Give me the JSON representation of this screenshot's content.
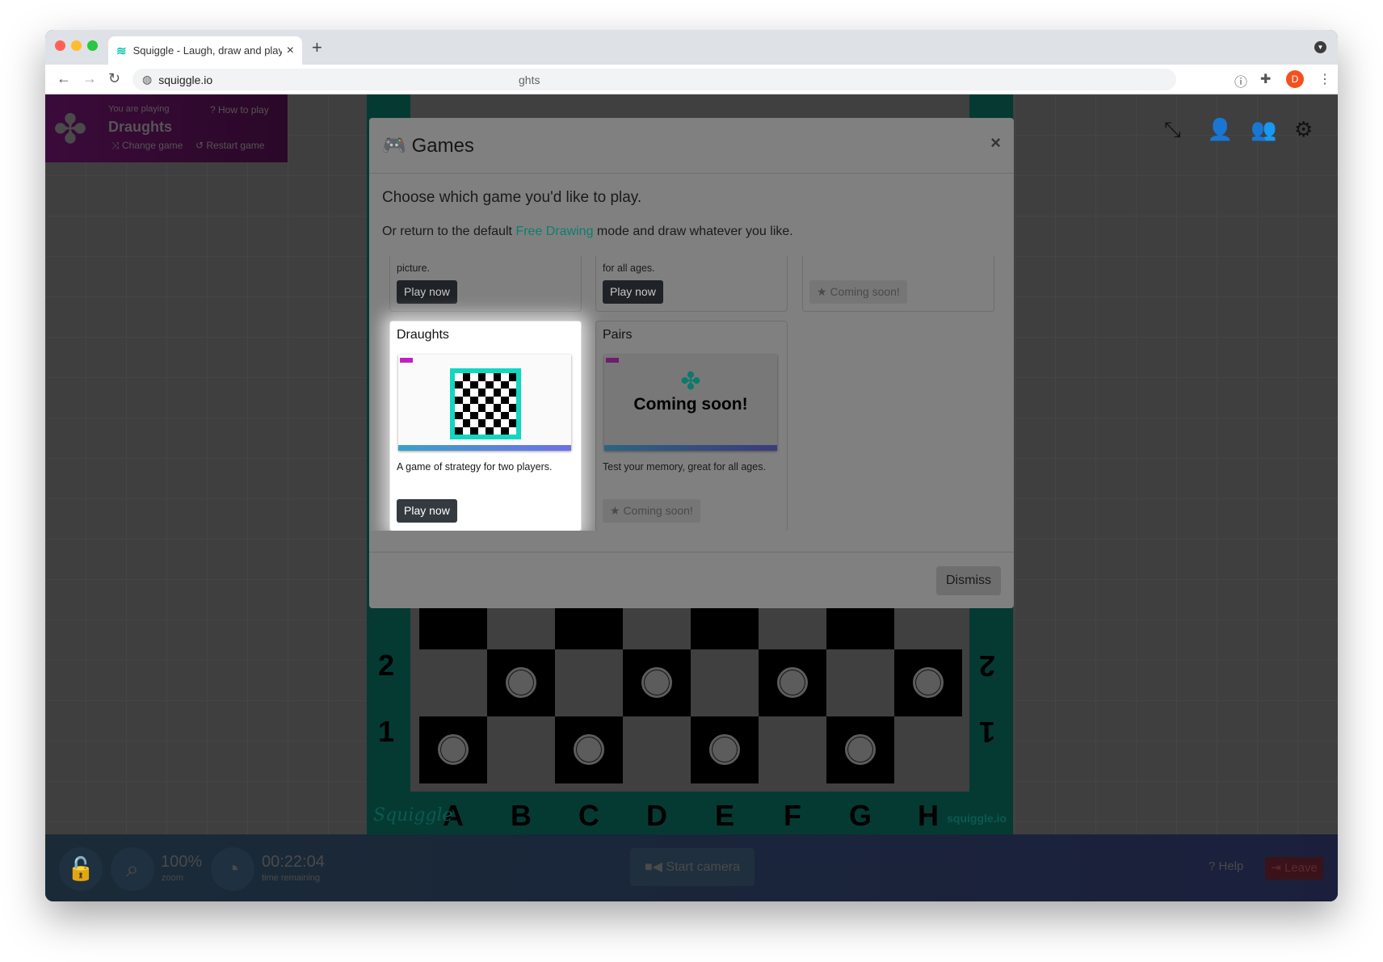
{
  "browser": {
    "tab_title": "Squiggle - Laugh, draw and play",
    "url": "squiggle.io",
    "omnibox_overflow_text": "ghts",
    "profile_initial": "D",
    "new_tab": "+",
    "close_tab": "×"
  },
  "game_panel": {
    "caption": "You are playing",
    "game_name": "Draughts",
    "how_to_play": "How to play",
    "change_game": "Change game",
    "restart_game": "Restart game"
  },
  "modal": {
    "title": "Games",
    "close": "×",
    "lead": "Choose which game you'd like to play.",
    "sub_before": "Or return to the default",
    "sub_link": "Free Drawing",
    "sub_after": "mode and draw whatever you like.",
    "top_row": [
      {
        "desc_tail": "picture.",
        "button": "Play now"
      },
      {
        "desc_tail": "for all ages.",
        "button": "Play now"
      },
      {
        "desc_tail": "",
        "button": "★ Coming soon!"
      }
    ],
    "cards": [
      {
        "title": "Draughts",
        "desc": "A game of strategy for two players.",
        "button": "Play now",
        "highlighted": true
      },
      {
        "title": "Pairs",
        "desc": "Test your memory, great for all ages.",
        "button": "★ Coming soon!",
        "thumb_text": "Coming soon!"
      }
    ],
    "dismiss": "Dismiss"
  },
  "board": {
    "ranks": [
      "2",
      "1"
    ],
    "files": [
      "A",
      "B",
      "C",
      "D",
      "E",
      "F",
      "G",
      "H"
    ],
    "brand_left": "Squiggle",
    "brand_right": "squiggle.io",
    "colors": {
      "frame": "#0fd3bd",
      "dark_square": "#000000"
    }
  },
  "bottom_bar": {
    "zoom_value": "100%",
    "zoom_label": "zoom",
    "time_value": "00:22:04",
    "time_label": "time remaining",
    "camera": "Start camera",
    "help": "Help",
    "leave": "Leave"
  },
  "colors": {
    "accent": "#12c9b0",
    "game_panel": "#8e1a8a",
    "leave": "#dc3545"
  }
}
